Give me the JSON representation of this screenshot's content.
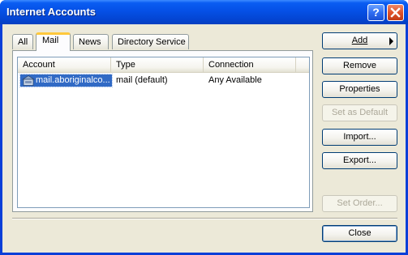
{
  "window": {
    "title": "Internet Accounts"
  },
  "titlebar": {
    "help_label": "?",
    "close_label": "✕"
  },
  "tabs": [
    {
      "label": "All"
    },
    {
      "label": "Mail"
    },
    {
      "label": "News"
    },
    {
      "label": "Directory Service"
    }
  ],
  "active_tab": "Mail",
  "list": {
    "columns": [
      "Account",
      "Type",
      "Connection"
    ],
    "rows": [
      {
        "account": "mail.aboriginalco...",
        "type": "mail (default)",
        "connection": "Any Available",
        "icon": "mail-account-icon",
        "selected": true
      }
    ]
  },
  "buttons": {
    "add": {
      "label": "Add",
      "enabled": true
    },
    "remove": {
      "label": "Remove",
      "enabled": true
    },
    "properties": {
      "label": "Properties",
      "enabled": true
    },
    "set_default": {
      "label": "Set as Default",
      "enabled": false
    },
    "import": {
      "label": "Import...",
      "enabled": true
    },
    "export": {
      "label": "Export...",
      "enabled": true
    },
    "set_order": {
      "label": "Set Order...",
      "enabled": false
    },
    "close": {
      "label": "Close",
      "enabled": true
    }
  },
  "colors": {
    "titlebar": "#0550e6",
    "dialog_bg": "#ece9d8",
    "selection": "#316ac5",
    "active_tab_accent": "#ffc83c"
  }
}
